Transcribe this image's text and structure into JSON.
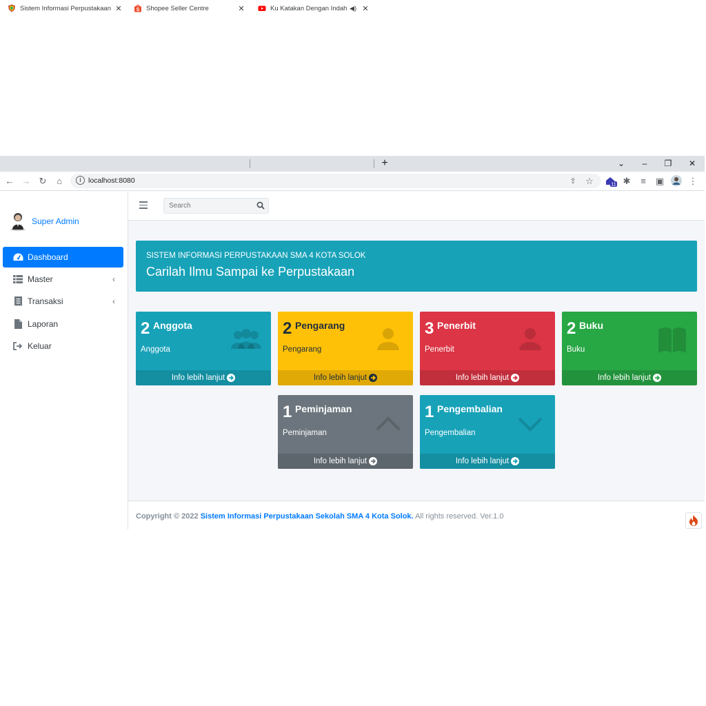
{
  "browser": {
    "tabs": [
      {
        "title": "Sistem Informasi Perpustakaan Se",
        "active": true
      },
      {
        "title": "Shopee Seller Centre",
        "active": false
      },
      {
        "title": "Ku Katakan Dengan Indah - ",
        "active": false
      }
    ],
    "new_tab": "+",
    "url": "localhost:8080",
    "extension_badge": "11"
  },
  "sidebar": {
    "user_name": "Super Admin",
    "items": [
      {
        "label": "Dashboard",
        "icon": "tachometer-icon",
        "active": true
      },
      {
        "label": "Master",
        "icon": "th-list-icon",
        "has_submenu": true
      },
      {
        "label": "Transaksi",
        "icon": "receipt-icon",
        "has_submenu": true
      },
      {
        "label": "Laporan",
        "icon": "file-icon"
      },
      {
        "label": "Keluar",
        "icon": "sign-out-icon"
      }
    ]
  },
  "topnav": {
    "search_placeholder": "Search"
  },
  "banner": {
    "subtitle": "SISTEM INFORMASI PERPUSTAKAAN SMA 4 KOTA SOLOK",
    "title": "Carilah Ilmu Sampai ke Perpustakaan"
  },
  "stats": [
    {
      "count": "2",
      "title": "Anggota",
      "label": "Anggota",
      "more": "Info lebih lanjut",
      "color": "#17a2b8",
      "icon": "users-icon"
    },
    {
      "count": "2",
      "title": "Pengarang",
      "label": "Pengarang",
      "more": "Info lebih lanjut",
      "color": "#ffc107",
      "icon": "user-icon"
    },
    {
      "count": "3",
      "title": "Penerbit",
      "label": "Penerbit",
      "more": "Info lebih lanjut",
      "color": "#dc3545",
      "icon": "user-icon"
    },
    {
      "count": "2",
      "title": "Buku",
      "label": "Buku",
      "more": "Info lebih lanjut",
      "color": "#28a745",
      "icon": "book-icon"
    },
    {
      "count": "1",
      "title": "Peminjaman",
      "label": "Peminjaman",
      "more": "Info lebih lanjut",
      "color": "#6c757d",
      "icon": "chevron-up-icon"
    },
    {
      "count": "1",
      "title": "Pengembalian",
      "label": "Pengembalian",
      "more": "Info lebih lanjut",
      "color": "#17a2b8",
      "icon": "chevron-down-icon"
    }
  ],
  "footer": {
    "copyright": "Copyright © 2022",
    "org": "Sistem Informasi Perpustakaan Sekolah SMA 4 Kota Solok.",
    "rights": "All rights reserved. Ver.1.0"
  }
}
